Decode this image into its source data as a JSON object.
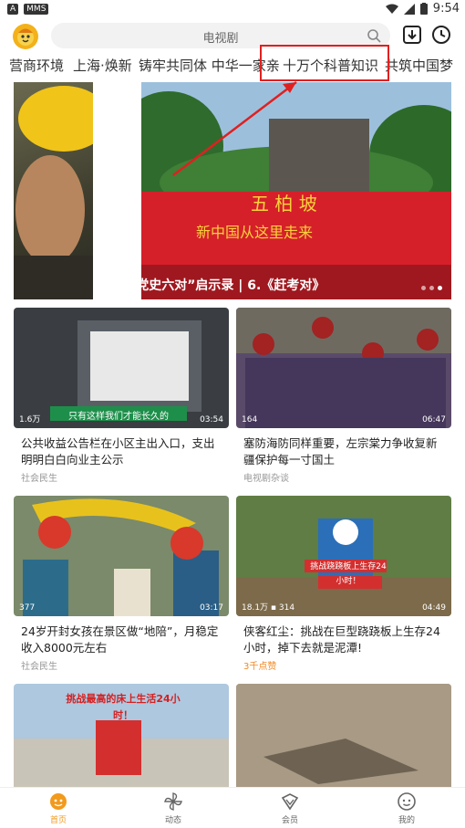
{
  "status_bar": {
    "badge1": "A",
    "badge2": "MMS",
    "time": "9:54"
  },
  "search": {
    "placeholder": "电视剧"
  },
  "tabs": [
    "营商环境",
    "上海·焕新",
    "铸牢共同体 中华一家亲",
    "十万个科普知识",
    "共筑中国梦"
  ],
  "banner": {
    "caption": "“党史六对”启示录 | 6.《赶考对》"
  },
  "cards": [
    {
      "title": "公共收益公告栏在小区主出入口，支出明明白白向业主公示",
      "tag": "社会民生",
      "plays": "1.6万",
      "duration": "03:54",
      "overlay": "只有这样我们才能长久的"
    },
    {
      "title": "塞防海防同样重要，左宗棠力争收复新疆保护每一寸国土",
      "tag": "电视剧杂谈",
      "plays": "164",
      "duration": "06:47",
      "overlay": ""
    },
    {
      "title": "24岁开封女孩在景区做“地陪”，月稳定收入8000元左右",
      "tag": "社会民生",
      "plays": "377",
      "duration": "03:17",
      "overlay": ""
    },
    {
      "title": "侠客红尘：挑战在巨型跷跷板上生存24小时，掉下去就是泥潭!",
      "tag": "3千点赞",
      "plays": "18.1万",
      "comments": "314",
      "duration": "04:49",
      "overlay": "挑战跷跷板上生存24小时！"
    },
    {
      "title": "",
      "tag": "",
      "plays": "",
      "duration": "",
      "overlay": "挑战最高的床上生活24小时！"
    },
    {
      "title": "",
      "tag": "",
      "plays": "",
      "duration": "",
      "overlay": ""
    }
  ],
  "bottom_nav": [
    {
      "label": "首页",
      "icon": "home-face-icon"
    },
    {
      "label": "动态",
      "icon": "pinwheel-icon"
    },
    {
      "label": "会员",
      "icon": "vip-icon"
    },
    {
      "label": "我的",
      "icon": "profile-icon"
    }
  ],
  "colors": {
    "accent": "#f29a1c",
    "highlight": "#e02020"
  }
}
